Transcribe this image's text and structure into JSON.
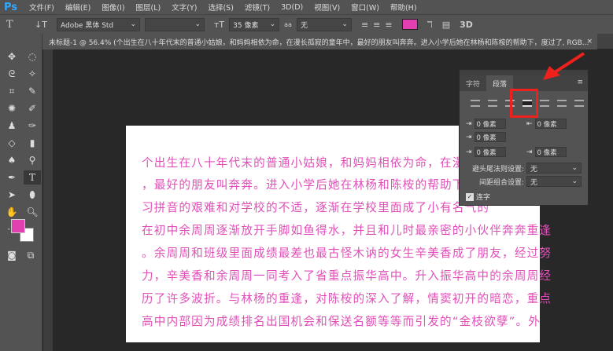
{
  "app": {
    "logo": "Ps"
  },
  "menu": [
    "文件(F)",
    "编辑(E)",
    "图像(I)",
    "图层(L)",
    "文字(Y)",
    "选择(S)",
    "滤镜(T)",
    "3D(D)",
    "视图(V)",
    "窗口(W)",
    "帮助(H)"
  ],
  "options": {
    "tool_icon": "T",
    "font_family": "Adobe 黑体 Std",
    "font_style": "",
    "font_size": "35 像素",
    "antialias_icon": "aa",
    "antialias": "无",
    "text_color": "#e23fb0",
    "three_d": "3D"
  },
  "document_tab": {
    "title": "未标题-1 @ 56.4% (个出生在八十年代末的普通小姑娘，和妈妈相依为命，在漫长孤寂的童年中，最好的朋友叫奔奔。进入小学后她在林杨和陈桉的帮助下，度过了, RGB...",
    "close": "×"
  },
  "colors": {
    "foreground": "#e23fb0",
    "background": "#ffffff",
    "text": "#e04fb8",
    "highlight": "#f0201c"
  },
  "text_lines": [
    "个出生在八十年代末的普通小姑娘，和妈妈相依为命，在漫长孤",
    "，最好的朋友叫奔奔。进入小学后她在林杨和陈桉的帮助下，度",
    "习拼音的艰难和对学校的不适，逐渐在学校里面成了小有名气的",
    "在初中余周周逐渐放开手脚如鱼得水，并且和儿时最亲密的小伙伴奔奔重逢",
    "。余周周和班级里面成绩最差也最古怪木讷的女生辛美香成了朋友，经过努",
    "力，辛美香和余周周一同考入了省重点振华高中。升入振华高中的余周周经",
    "历了许多波折。与林杨的重逢，对陈桉的深入了解，情窦初开的暗恋，重点",
    "高中内部因为成绩排名出国机会和保送名额等等而引发的“金枝欲孽”。外"
  ],
  "panel": {
    "tabs": [
      "字符",
      "段落"
    ],
    "left_indent": "0 像素",
    "right_indent": "0 像素",
    "first_line_indent": "0 像素",
    "space_before": "0 像素",
    "space_after": "0 像素",
    "kinsoku_label": "避头尾法则设置:",
    "kinsoku_value": "无",
    "mojikumi_label": "间距组合设置:",
    "mojikumi_value": "无",
    "hyphenate_label": "连字",
    "hyphenate_checked": true
  }
}
